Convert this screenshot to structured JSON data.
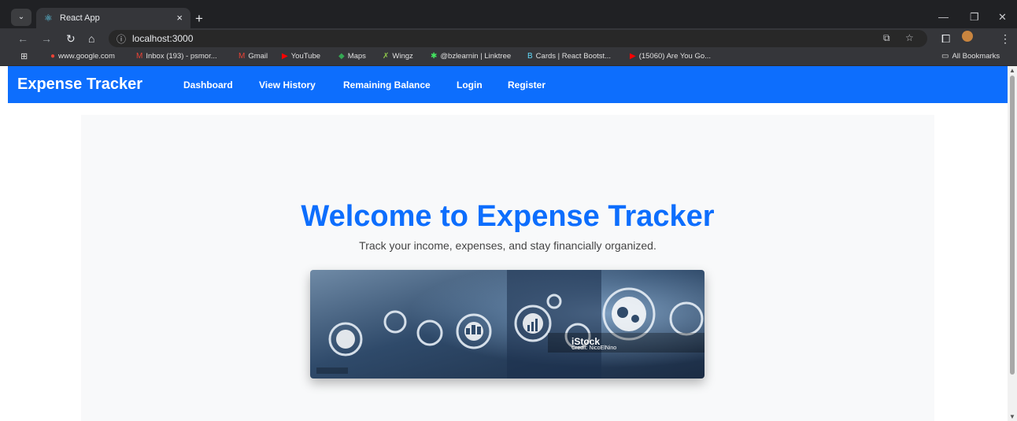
{
  "browser": {
    "tab_title": "React App",
    "tab_close": "×",
    "new_tab": "+",
    "url": "localhost:3000",
    "minimize": "—",
    "restore": "❐",
    "close": "✕",
    "menu": "⋮"
  },
  "bookmarks": [
    {
      "label": "www.google.com",
      "icon": "google-icon"
    },
    {
      "label": "Inbox (193) - psmor...",
      "icon": "gmail-icon"
    },
    {
      "label": "Gmail",
      "icon": "gmail-icon"
    },
    {
      "label": "YouTube",
      "icon": "youtube-icon"
    },
    {
      "label": "Maps",
      "icon": "maps-icon"
    },
    {
      "label": "Wingz",
      "icon": "wingz-icon"
    },
    {
      "label": "@bzlearnin | Linktree",
      "icon": "linktree-icon"
    },
    {
      "label": "Cards | React Bootst...",
      "icon": "bootstrap-icon"
    },
    {
      "label": "(15060) Are You Go...",
      "icon": "youtube-icon"
    }
  ],
  "all_bookmarks": "All Bookmarks",
  "navbar": {
    "brand": "Expense Tracker",
    "links": [
      "Dashboard",
      "View History",
      "Remaining Balance",
      "Login",
      "Register"
    ]
  },
  "hero": {
    "title": "Welcome to Expense Tracker",
    "subtitle": "Track your income, expenses, and stay financially organized.",
    "image_watermark": "iStock",
    "image_credit": "Credit: NicoElNino"
  },
  "colors": {
    "navbar": "#0d6efd",
    "title": "#0d6efd",
    "chrome": "#202124"
  }
}
